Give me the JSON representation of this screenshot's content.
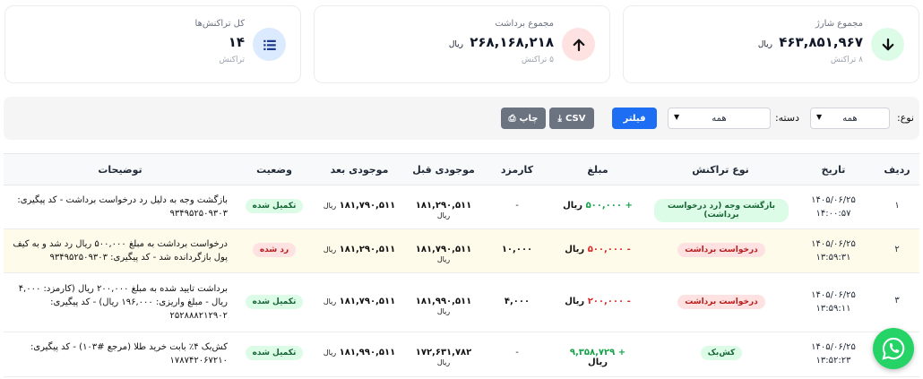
{
  "cards": {
    "total_charge": {
      "title": "مجموع شارژ",
      "value": "۴۶۳,۸۵۱,۹۶۷",
      "unit": "ریال",
      "sub": "۸ تراکنش",
      "icon": "arrow-down-icon",
      "icon_color": "#dcfce7"
    },
    "total_withdraw": {
      "title": "مجموع برداشت",
      "value": "۲۶۸,۱۶۸,۲۱۸",
      "unit": "ریال",
      "sub": "۵ تراکنش",
      "icon": "arrow-up-icon",
      "icon_color": "#fee2e2"
    },
    "total_tx": {
      "title": "کل تراکنش‌ها",
      "value": "۱۴",
      "sub": "تراکنش",
      "icon": "list-icon",
      "icon_color": "#dbeafe"
    }
  },
  "filters": {
    "type_label": "نوع:",
    "type_value": "همه",
    "category_label": "دسته:",
    "category_value": "همه",
    "filter_button": "فیلتر",
    "csv_button": "CSV",
    "print_button": "چاپ"
  },
  "table": {
    "headers": {
      "row": "ردیف",
      "date": "تاریخ",
      "type": "نوع تراکنش",
      "amount": "مبلغ",
      "fee": "کارمزد",
      "balance_before": "موجودی قبل",
      "balance_after": "موجودی بعد",
      "status": "وضعیت",
      "desc": "توضیحات"
    },
    "rows": [
      {
        "idx": "۱",
        "date": "۱۴۰۵/۰۶/۲۵",
        "time": "۱۴:۰۰:۵۷",
        "type": "بازگشت وجه (رد درخواست برداشت)",
        "amount": "+ ۵۰۰,۰۰۰",
        "unit": "ریال",
        "fee": "-",
        "before": "۱۸۱,۲۹۰,۵۱۱",
        "after": "۱۸۱,۷۹۰,۵۱۱",
        "status": "تکمیل شده",
        "desc1": "بازگشت وجه به دلیل رد درخواست برداشت - کد پیگیری:",
        "desc2": "۹۳۴۹۵۲۵۰۹۳۰۳",
        "desc3": ""
      },
      {
        "idx": "۲",
        "date": "۱۴۰۵/۰۶/۲۵",
        "time": "۱۳:۵۹:۳۱",
        "type": "درخواست برداشت",
        "amount": "- ۵۰۰,۰۰۰",
        "unit": "ریال",
        "fee": "۱۰,۰۰۰",
        "before": "۱۸۱,۷۹۰,۵۱۱",
        "after": "۱۸۱,۲۹۰,۵۱۱",
        "status": "رد شده",
        "desc1": "درخواست برداشت به مبلغ ۵۰۰,۰۰۰ ریال رد شد و به کیف",
        "desc2": "پول بازگردانده شد - کد پیگیری: ۹۳۴۹۵۲۵۰۹۳۰۳",
        "desc3": ""
      },
      {
        "idx": "۳",
        "date": "۱۴۰۵/۰۶/۲۵",
        "time": "۱۳:۵۹:۱۱",
        "type": "درخواست برداشت",
        "amount": "- ۲۰۰,۰۰۰",
        "unit": "ریال",
        "fee": "۴,۰۰۰",
        "before": "۱۸۱,۹۹۰,۵۱۱",
        "after": "۱۸۱,۷۹۰,۵۱۱",
        "status": "تکمیل شده",
        "desc1": "برداشت تایید شده به مبلغ ۲۰۰,۰۰۰ ریال (کارمزد: ۴,۰۰۰",
        "desc2": "ریال - مبلغ واریزی: ۱۹۶,۰۰۰ ریال) - کد پیگیری:",
        "desc3": "۲۵۲۸۸۸۲۱۲۹۰۲"
      },
      {
        "idx": "۴",
        "date": "۱۴۰۵/۰۶/۲۵",
        "time": "۱۳:۵۲:۲۳",
        "type": "کش‌بک",
        "amount": "+ ۹,۳۵۸,۷۲۹",
        "unit": "ریال",
        "fee": "-",
        "before": "۱۷۲,۶۳۱,۷۸۲",
        "after": "۱۸۱,۹۹۰,۵۱۱",
        "status": "تکمیل شده",
        "desc1": "کش‌بک ۴٪ بابت خرید طلا (مرجع #۱۰۳) - کد پیگیری:",
        "desc2": "۱۷۸۷۴۲۰۶۷۲۱۰",
        "desc3": ""
      }
    ]
  }
}
